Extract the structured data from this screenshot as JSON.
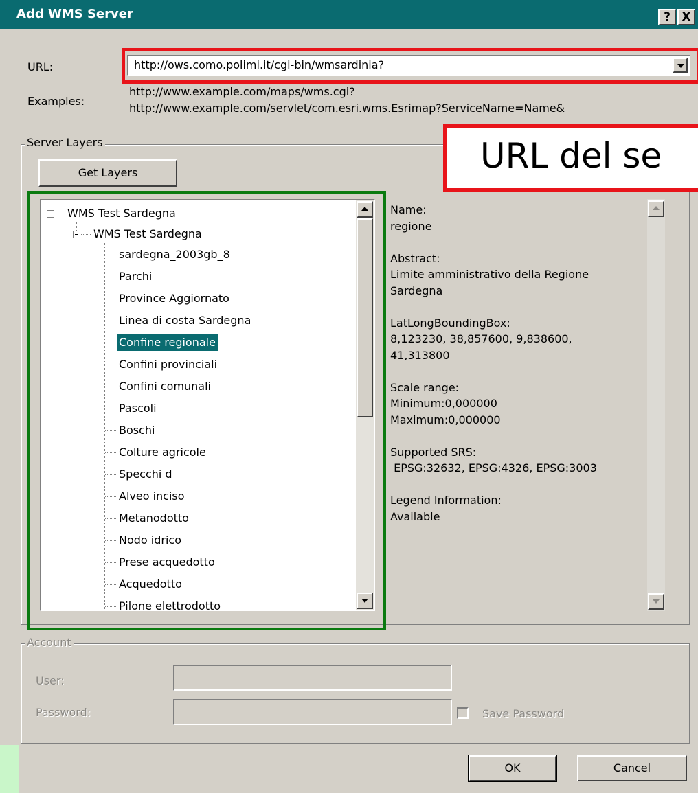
{
  "window": {
    "title": "Add WMS Server",
    "help_label": "?",
    "close_label": "X"
  },
  "url": {
    "label": "URL:",
    "value": "http://ows.como.polimi.it/cgi-bin/wmsardinia?",
    "examples_label": "Examples:",
    "examples": [
      "http://www.example.com/maps/wms.cgi?",
      "http://www.example.com/servlet/com.esri.wms.Esrimap?ServiceName=Name&"
    ]
  },
  "server_layers": {
    "legend": "Server Layers",
    "get_layers_label": "Get Layers",
    "root": "WMS Test Sardegna",
    "child": "WMS Test Sardegna",
    "layers": [
      "sardegna_2003gb_8",
      "Parchi",
      "Province Aggiornato",
      "Linea di costa Sardegna",
      "Confine regionale",
      "Confini provinciali",
      "Confini comunali",
      "Pascoli",
      "Boschi",
      "Colture agricole",
      "Specchi d",
      "Alveo inciso",
      "Metanodotto",
      "Nodo idrico",
      "Prese acquedotto",
      "Acquedotto",
      "Pilone elettrodotto"
    ],
    "selected_index": 4
  },
  "layer_info": {
    "lines": [
      "Name:",
      "regione",
      "",
      "Abstract:",
      "Limite amministrativo della Regione",
      "Sardegna",
      "",
      "LatLongBoundingBox:",
      "8,123230, 38,857600, 9,838600,",
      "41,313800",
      "",
      "Scale range:",
      "Minimum:0,000000",
      "Maximum:0,000000",
      "",
      "Supported SRS:",
      " EPSG:32632, EPSG:4326, EPSG:3003",
      "",
      "Legend Information:",
      "Available"
    ]
  },
  "account": {
    "legend": "Account",
    "user_label": "User:",
    "password_label": "Password:",
    "user_value": "",
    "password_value": "",
    "save_password_label": "Save Password"
  },
  "buttons": {
    "ok": "OK",
    "cancel": "Cancel"
  },
  "annotation": {
    "text": "URL del se"
  },
  "colors": {
    "titlebar": "#0a6b70",
    "selection": "#0a6b70",
    "annotation_red": "#e8141a",
    "annotation_green": "#0a7a10"
  }
}
